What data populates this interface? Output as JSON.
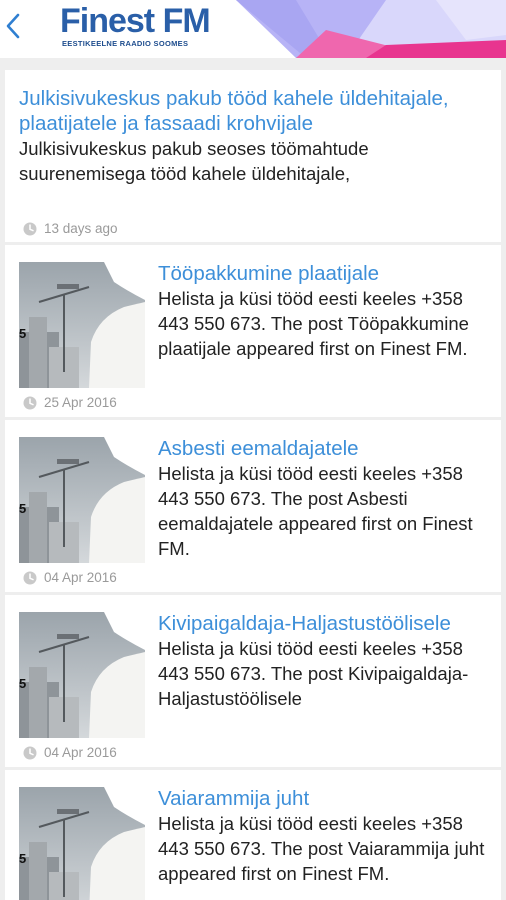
{
  "header": {
    "logo_text": "Finest FM",
    "logo_subtitle": "EESTIKEELNE RAADIO SOOMES"
  },
  "articles": [
    {
      "title": "Julkisivukeskus pakub tööd kahele üldehitajale, plaatijatele ja fassaadi krohvijale",
      "excerpt": "Julkisivukeskus pakub seoses töömahtude suurenemisega tööd kahele üldehitajale,",
      "date": "13 days ago"
    },
    {
      "title": "Tööpakkumine plaatijale",
      "excerpt": "Helista ja küsi tööd eesti keeles +358 443 550 673. The post Tööpakkumine plaatijale appeared first on Finest FM.",
      "date": "25 Apr 2016"
    },
    {
      "title": "Asbesti eemaldajatele",
      "excerpt": "Helista ja küsi tööd eesti keeles +358 443 550 673. The post Asbesti eemaldajatele appeared first on Finest FM.",
      "date": "04 Apr 2016"
    },
    {
      "title": "Kivipaigaldaja-Haljastustöölisele",
      "excerpt": "Helista ja küsi tööd eesti keeles +358 443 550 673. The post Kivipaigaldaja-Haljastustöölisele",
      "date": "04 Apr 2016"
    },
    {
      "title": "Vaiarammija juht",
      "excerpt": "Helista ja küsi tööd eesti keeles +358 443 550 673. The post Vaiarammija juht appeared first on Finest FM.",
      "date": ""
    }
  ],
  "colors": {
    "title": "#3d8fd9",
    "brand": "#2a5fa8",
    "accent_pink": "#e8358f",
    "accent_lavender": "#a9a6f2",
    "meta": "#9a9a9a"
  },
  "icons": {
    "back": "chevron-left-icon",
    "date": "clock-icon"
  }
}
